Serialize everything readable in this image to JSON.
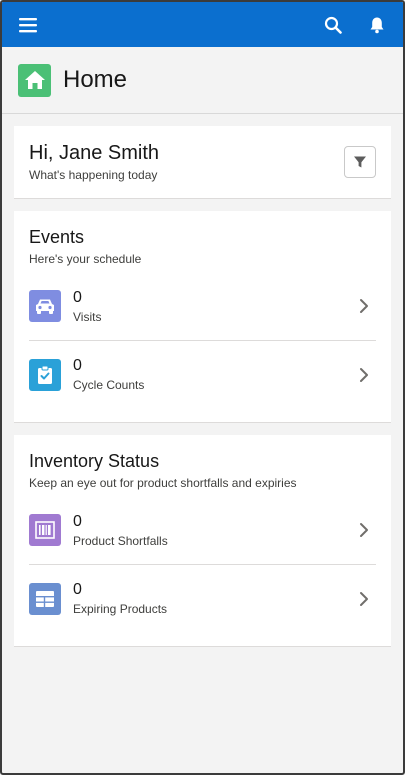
{
  "topbar": {
    "menu_icon": "hamburger-menu-icon",
    "search_icon": "search-icon",
    "bell_icon": "bell-icon",
    "color": "#0b6fcf"
  },
  "page": {
    "title": "Home",
    "icon": "home-icon",
    "icon_color": "#4bc076"
  },
  "greeting": {
    "title": "Hi, Jane Smith",
    "subtitle": "What's happening today",
    "filter_icon": "filter-icon"
  },
  "events": {
    "title": "Events",
    "subtitle": "Here's your schedule",
    "items": [
      {
        "count": "0",
        "label": "Visits",
        "icon": "car-icon",
        "color": "#7f8de1"
      },
      {
        "count": "0",
        "label": "Cycle Counts",
        "icon": "clipboard-check-icon",
        "color": "#2aa1d8"
      }
    ]
  },
  "inventory": {
    "title": "Inventory Status",
    "subtitle": "Keep an eye out for product shortfalls and expiries",
    "items": [
      {
        "count": "0",
        "label": "Product Shortfalls",
        "icon": "barcode-icon",
        "color": "#a07ad1"
      },
      {
        "count": "0",
        "label": "Expiring Products",
        "icon": "table-icon",
        "color": "#6a8fd0"
      }
    ]
  }
}
